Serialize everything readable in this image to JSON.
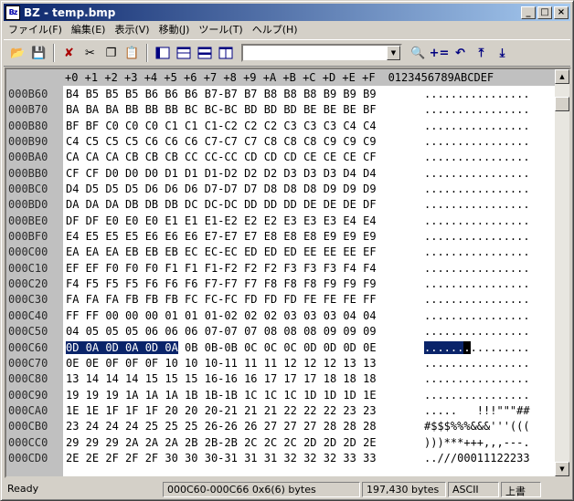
{
  "window": {
    "title": "BZ - temp.bmp",
    "app_icon": "Bz"
  },
  "menu": [
    "ファイル(F)",
    "編集(E)",
    "表示(V)",
    "移動(J)",
    "ツール(T)",
    "ヘルプ(H)"
  ],
  "toolbar": {
    "search_value": "",
    "icons": [
      "open-folder-icon",
      "save-icon",
      "delete-icon",
      "cut-icon",
      "copy-icon",
      "paste-icon",
      "layout-single-icon",
      "layout-split-h-icon",
      "layout-split-h2-icon",
      "layout-split-v-icon",
      "find-icon",
      "add-icon",
      "undo-icon",
      "jump-top-icon",
      "jump-down-icon"
    ]
  },
  "header": {
    "hex_cols": "+0 +1 +2 +3 +4 +5 +6 +7 +8 +9 +A +B +C +D +E +F",
    "ascii_cols": "0123456789ABCDEF"
  },
  "rows": [
    {
      "addr": "000B60",
      "hex": "B4 B5 B5 B5 B6 B6 B6 B7-B7 B7 B8 B8 B8 B9 B9 B9",
      "ascii": "................"
    },
    {
      "addr": "000B70",
      "hex": "BA BA BA BB BB BB BC BC-BC BD BD BD BE BE BE BF",
      "ascii": "................"
    },
    {
      "addr": "000B80",
      "hex": "BF BF C0 C0 C0 C1 C1 C1-C2 C2 C2 C3 C3 C3 C4 C4",
      "ascii": "................"
    },
    {
      "addr": "000B90",
      "hex": "C4 C5 C5 C5 C6 C6 C6 C7-C7 C7 C8 C8 C8 C9 C9 C9",
      "ascii": "................"
    },
    {
      "addr": "000BA0",
      "hex": "CA CA CA CB CB CB CC CC-CC CD CD CD CE CE CE CF",
      "ascii": "................"
    },
    {
      "addr": "000BB0",
      "hex": "CF CF D0 D0 D0 D1 D1 D1-D2 D2 D2 D3 D3 D3 D4 D4",
      "ascii": "................"
    },
    {
      "addr": "000BC0",
      "hex": "D4 D5 D5 D5 D6 D6 D6 D7-D7 D7 D8 D8 D8 D9 D9 D9",
      "ascii": "................"
    },
    {
      "addr": "000BD0",
      "hex": "DA DA DA DB DB DB DC DC-DC DD DD DD DE DE DE DF",
      "ascii": "................"
    },
    {
      "addr": "000BE0",
      "hex": "DF DF E0 E0 E0 E1 E1 E1-E2 E2 E2 E3 E3 E3 E4 E4",
      "ascii": "................"
    },
    {
      "addr": "000BF0",
      "hex": "E4 E5 E5 E5 E6 E6 E6 E7-E7 E7 E8 E8 E8 E9 E9 E9",
      "ascii": "................"
    },
    {
      "addr": "000C00",
      "hex": "EA EA EA EB EB EB EC EC-EC ED ED ED EE EE EE EF",
      "ascii": "................"
    },
    {
      "addr": "000C10",
      "hex": "EF EF F0 F0 F0 F1 F1 F1-F2 F2 F2 F3 F3 F3 F4 F4",
      "ascii": "................"
    },
    {
      "addr": "000C20",
      "hex": "F4 F5 F5 F5 F6 F6 F6 F7-F7 F7 F8 F8 F8 F9 F9 F9",
      "ascii": "................"
    },
    {
      "addr": "000C30",
      "hex": "FA FA FA FB FB FB FC FC-FC FD FD FD FE FE FE FF",
      "ascii": "................"
    },
    {
      "addr": "000C40",
      "hex": "FF FF 00 00 00 01 01 01-02 02 02 03 03 03 04 04",
      "ascii": "................"
    },
    {
      "addr": "000C50",
      "hex": "04 05 05 05 06 06 06 07-07 07 08 08 08 09 09 09",
      "ascii": "................"
    },
    {
      "addr": "000C60",
      "hex_sel": "0D 0A 0D 0A 0D 0A",
      "hex": " 0B 0B-0B 0C 0C 0C 0D 0D 0D 0E",
      "ascii_sel": "......",
      "ascii_cur": ".",
      "ascii": "........."
    },
    {
      "addr": "000C70",
      "hex": "0E 0E 0F 0F 0F 10 10 10-11 11 11 12 12 12 13 13",
      "ascii": "................"
    },
    {
      "addr": "000C80",
      "hex": "13 14 14 14 15 15 15 16-16 16 17 17 17 18 18 18",
      "ascii": "................"
    },
    {
      "addr": "000C90",
      "hex": "19 19 19 1A 1A 1A 1B 1B-1B 1C 1C 1C 1D 1D 1D 1E",
      "ascii": "................"
    },
    {
      "addr": "000CA0",
      "hex": "1E 1E 1F 1F 1F 20 20 20-21 21 21 22 22 22 23 23",
      "ascii": ".....   !!!\"\"\"##"
    },
    {
      "addr": "000CB0",
      "hex": "23 24 24 24 25 25 25 26-26 26 27 27 27 28 28 28",
      "ascii": "#$$$%%%&&&'''((("
    },
    {
      "addr": "000CC0",
      "hex": "29 29 29 2A 2A 2A 2B 2B-2B 2C 2C 2C 2D 2D 2D 2E",
      "ascii": ")))***+++,,,---."
    },
    {
      "addr": "000CD0",
      "hex": "2E 2E 2F 2F 2F 30 30 30-31 31 31 32 32 32 33 33",
      "ascii": "..///00011122233"
    }
  ],
  "status": {
    "ready": "Ready",
    "range": "000C60-000C66 0x6(6) bytes",
    "size": "197,430 bytes",
    "charset": "ASCII",
    "mode": "上書"
  }
}
